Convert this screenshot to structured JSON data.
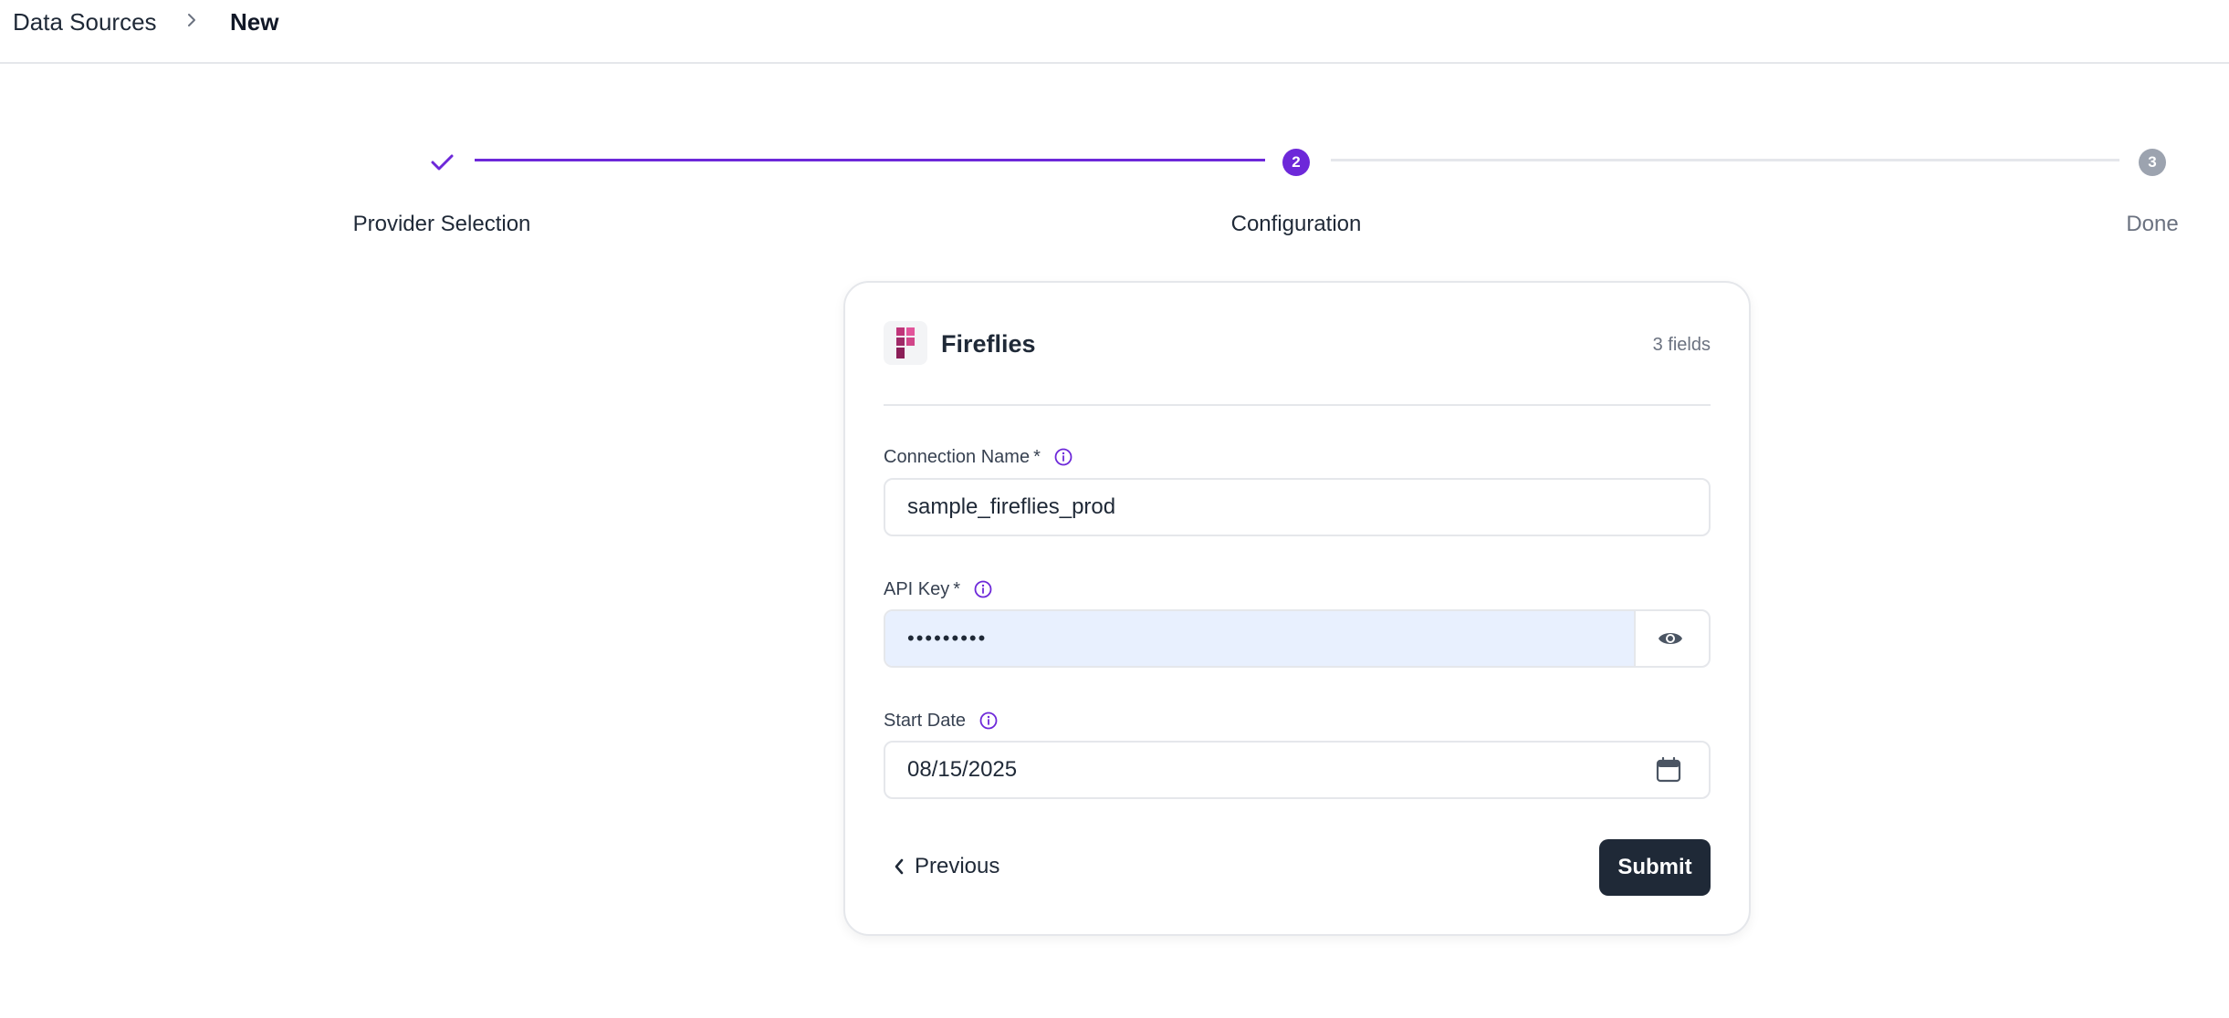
{
  "breadcrumb": {
    "root": "Data Sources",
    "current": "New"
  },
  "stepper": {
    "steps": [
      {
        "label": "Provider Selection",
        "status": "completed",
        "marker": ""
      },
      {
        "label": "Configuration",
        "status": "active",
        "marker": "2"
      },
      {
        "label": "Done",
        "status": "pending",
        "marker": "3"
      }
    ]
  },
  "card": {
    "provider_name": "Fireflies",
    "field_count": "3 fields",
    "fields": {
      "connection_name": {
        "label": "Connection Name",
        "required_mark": "*",
        "value": "sample_fireflies_prod"
      },
      "api_key": {
        "label": "API Key",
        "required_mark": "*",
        "value": "•••••••••"
      },
      "start_date": {
        "label": "Start Date",
        "value": "08/15/2025"
      }
    },
    "previous_label": "Previous",
    "submit_label": "Submit"
  },
  "colors": {
    "accent": "#6d28d9",
    "logo": "#c0357a",
    "submit_bg": "#1f2937",
    "autofill_bg": "#e8f0fe"
  }
}
